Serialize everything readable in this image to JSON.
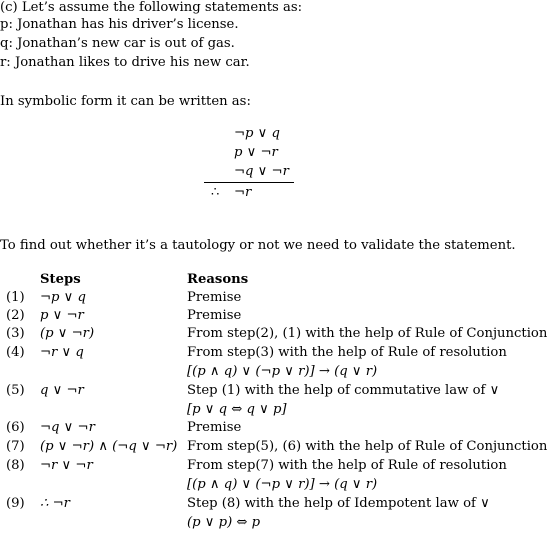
{
  "intro": {
    "heading": "(c) Let’s assume the following statements as:",
    "definitions": [
      "p:  Jonathan has his driver’s license.",
      "q:  Jonathan’s new car is out of gas.",
      "r:  Jonathan likes to drive his new car."
    ],
    "symbolic_intro": "In symbolic form it can be written as:"
  },
  "argument": {
    "premises": [
      "¬p ∨ q",
      "p ∨ ¬r",
      "¬q ∨ ¬r"
    ],
    "therefore_symbol": "∴",
    "conclusion": "¬r"
  },
  "validation_text": "To find out whether it’s a tautology or not we need to validate the statement.",
  "table": {
    "headers": {
      "steps": "Steps",
      "reasons": "Reasons"
    },
    "rows": [
      {
        "num": "(1)",
        "step": "¬p ∨ q",
        "reason": [
          "Premise"
        ]
      },
      {
        "num": "(2)",
        "step": "p ∨ ¬r",
        "reason": [
          "Premise"
        ]
      },
      {
        "num": "(3)",
        "step": "(p ∨ ¬r)",
        "reason": [
          "From step(2), (1) with the help of Rule of Conjunction"
        ]
      },
      {
        "num": "(4)",
        "step": "¬r ∨ q",
        "reason": [
          "From step(3) with the help of Rule of resolution",
          "[(p ∧ q) ∨ (¬p ∨ r)] → (q ∨ r)"
        ]
      },
      {
        "num": "(5)",
        "step": "q ∨ ¬r",
        "reason": [
          "Step (1) with the help of commutative law of ∨",
          "[p ∨ q ⇔ q ∨ p]"
        ]
      },
      {
        "num": "(6)",
        "step": "¬q ∨ ¬r",
        "reason": [
          "Premise"
        ]
      },
      {
        "num": "(7)",
        "step": "(p ∨ ¬r) ∧ (¬q ∨ ¬r)",
        "reason": [
          "From step(5), (6) with the help of Rule of Conjunction"
        ]
      },
      {
        "num": "(8)",
        "step": "¬r ∨ ¬r",
        "reason": [
          "From step(7) with the help of Rule of resolution",
          "[(p ∧ q) ∨ (¬p ∨ r)] → (q ∨ r)"
        ]
      },
      {
        "num": "(9)",
        "step": "∴ ¬r",
        "reason": [
          "Step (8) with the help of Idempotent law of ∨",
          "(p ∨ p) ⇔ p"
        ]
      }
    ]
  }
}
